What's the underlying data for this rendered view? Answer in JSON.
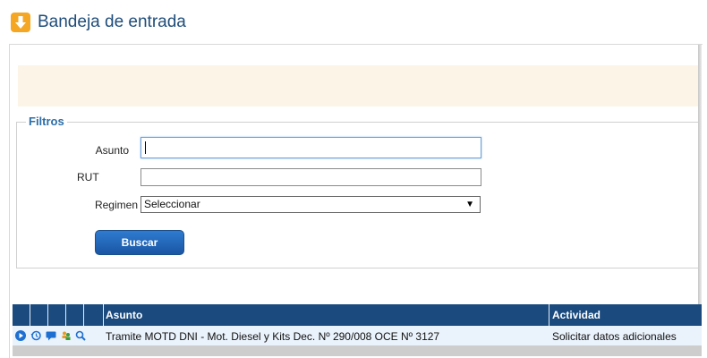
{
  "page": {
    "title": "Bandeja de entrada",
    "header_icon": "download-arrow-icon",
    "accent_color": "#f5a623",
    "title_color": "#1f4d7a"
  },
  "filters": {
    "legend": "Filtros",
    "asunto": {
      "label": "Asunto",
      "value": "",
      "placeholder": ""
    },
    "rut": {
      "label": "RUT",
      "value": "",
      "placeholder": ""
    },
    "regimen": {
      "label": "Regimen",
      "selected": "Seleccionar",
      "arrow": "▼"
    },
    "search_button": "Buscar"
  },
  "table": {
    "header_color": "#1a4a7e",
    "columns": [
      "Asunto",
      "Actividad"
    ],
    "action_icons": [
      "play-icon",
      "history-icon",
      "comment-icon",
      "reassign-icon",
      "search-icon"
    ],
    "rows": [
      {
        "asunto": "Tramite MOTD DNI - Mot. Diesel y Kits Dec. Nº 290/008 OCE Nº 3127",
        "actividad": "Solicitar datos adicionales"
      }
    ]
  }
}
